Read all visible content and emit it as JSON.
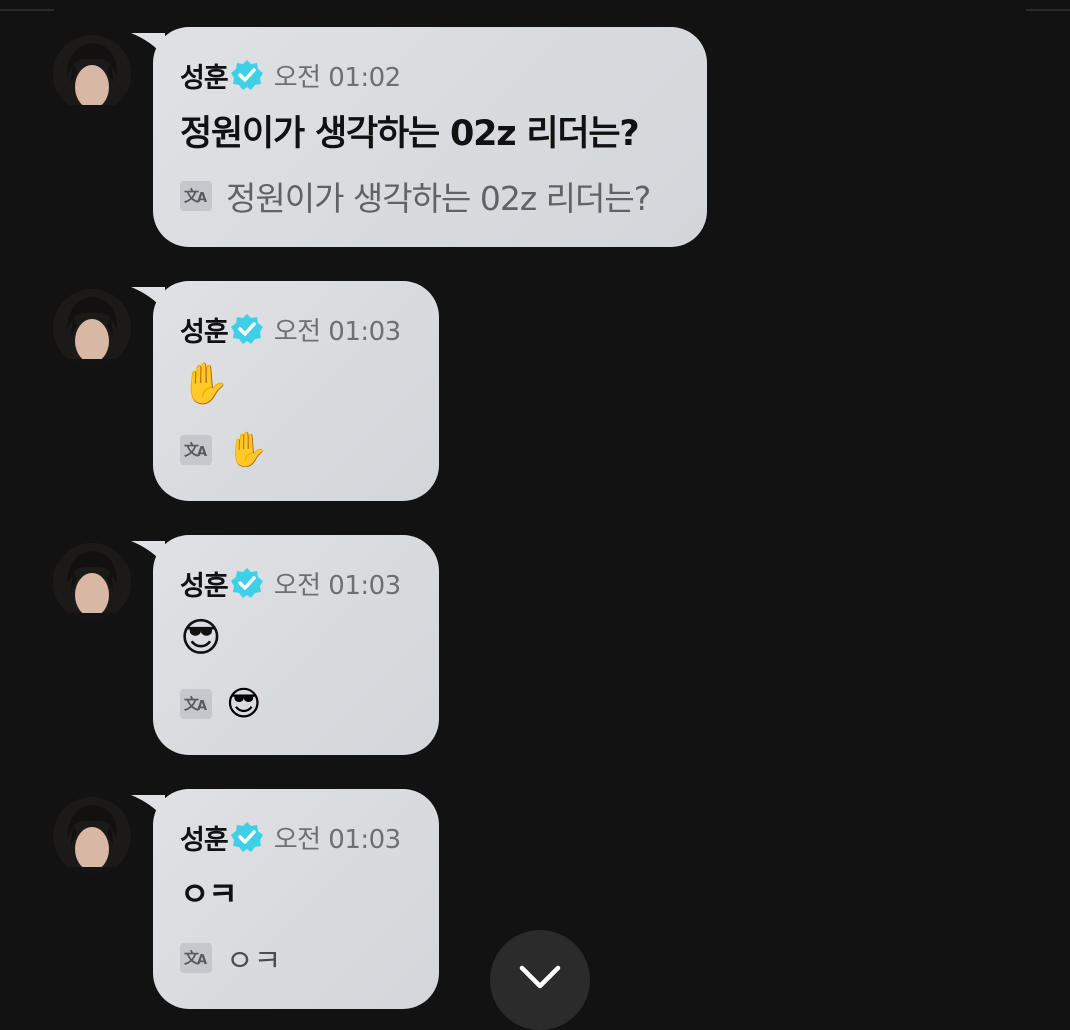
{
  "messages": [
    {
      "sender": "성훈",
      "time": "오전 01:02",
      "text": "정원이가 생각하는 02z 리더는?",
      "translation": "정원이가 생각하는 02z 리더는?"
    },
    {
      "sender": "성훈",
      "time": "오전 01:03",
      "text": "✋",
      "translation": "✋"
    },
    {
      "sender": "성훈",
      "time": "오전 01:03",
      "text": "😎",
      "translation": "😎"
    },
    {
      "sender": "성훈",
      "time": "오전 01:03",
      "text": "ㅇㅋ",
      "translation": "ㅇㅋ"
    }
  ],
  "icons": {
    "verified": "verified-badge-icon",
    "translate": "translate-icon",
    "scroll_down": "chevron-down-icon"
  },
  "colors": {
    "background": "#121212",
    "bubble": "#dcdfe2",
    "verified": "#3fd0e8",
    "time": "#6c6f74",
    "scroll_button": "#2b2b2c"
  }
}
